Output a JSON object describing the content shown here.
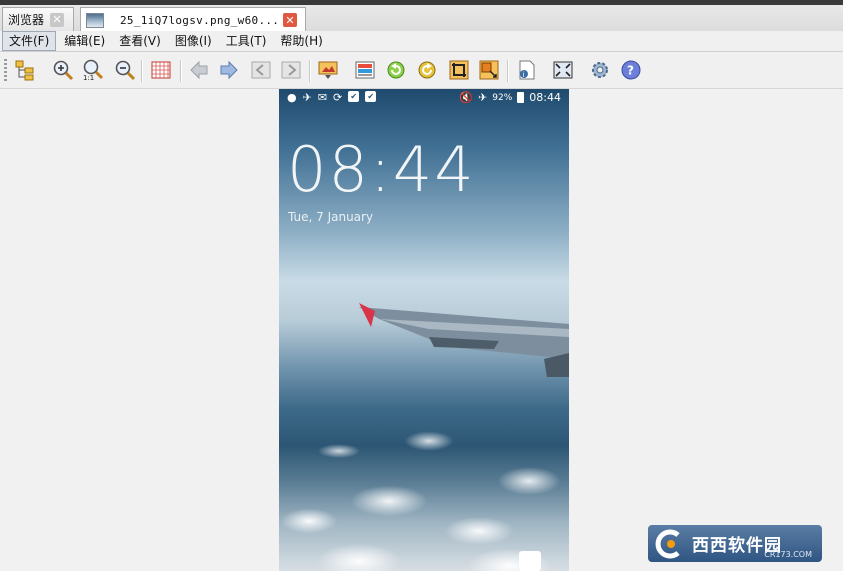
{
  "tabs": [
    {
      "label": "浏览器",
      "active": false
    },
    {
      "label": "25_1iQ7logsv.png_w60...",
      "active": true
    }
  ],
  "menu": [
    "文件(F)",
    "编辑(E)",
    "查看(V)",
    "图像(I)",
    "工具(T)",
    "帮助(H)"
  ],
  "toolbar_icons": [
    "folder-tree-icon",
    "zoom-in-icon",
    "zoom-actual-icon",
    "zoom-out-icon",
    "grid-icon",
    "arrow-left-icon",
    "arrow-right-icon",
    "prev-page-icon",
    "next-page-icon",
    "slideshow-icon",
    "image-info-icon",
    "rotate-left-icon",
    "rotate-right-icon",
    "crop-icon",
    "resize-icon",
    "properties-icon",
    "fullscreen-icon",
    "settings-icon",
    "help-icon"
  ],
  "phone": {
    "status_left": [
      "●",
      "✈",
      "✉",
      "⟳",
      "✔",
      "✔"
    ],
    "battery": "92%",
    "status_time": "08:44",
    "clock": "08:44",
    "date": "Tue, 7 January"
  },
  "watermark": {
    "text": "西西软件园",
    "sub": "CR173.COM"
  },
  "colors": {
    "accent_close": "#e0583f",
    "toolbar_bg": "#f0f0f0"
  }
}
